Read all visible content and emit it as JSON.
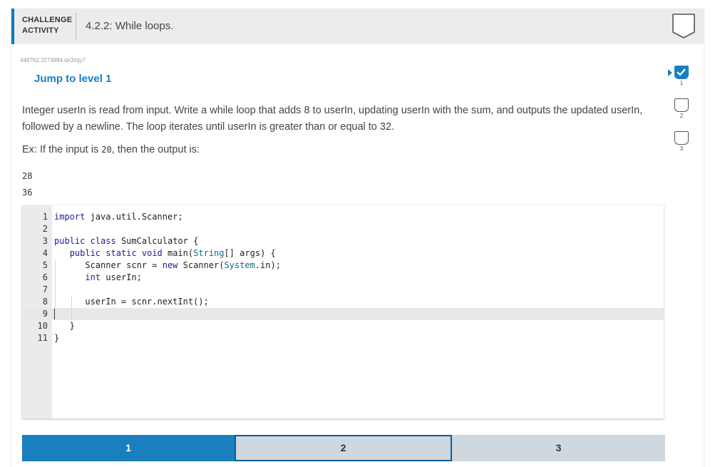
{
  "header": {
    "type_line1": "CHALLENGE",
    "type_line2": "ACTIVITY",
    "title": "4.2.2: While loops."
  },
  "activity_id": "448762.3274894.qx3zqy7",
  "jump_label": "Jump to level 1",
  "prompt": {
    "text": "Integer userIn is read from input. Write a while loop that adds 8 to userIn, updating userIn with the sum, and outputs the updated userIn, followed by a newline. The loop iterates until userIn is greater than or equal to 32.",
    "example_prefix": "Ex: If the input is ",
    "example_value": "20",
    "example_suffix": ", then the output is:",
    "output_lines": [
      "28",
      "36"
    ]
  },
  "code": {
    "line_numbers": [
      "1",
      "2",
      "3",
      "4",
      "5",
      "6",
      "7",
      "8",
      "9",
      "10",
      "11"
    ],
    "lines": [
      "import java.util.Scanner;",
      "",
      "public class SumCalculator {",
      "   public static void main(String[] args) {",
      "      Scanner scnr = new Scanner(System.in);",
      "      int userIn;",
      "",
      "      userIn = scnr.nextInt();",
      "",
      "   }",
      "}"
    ],
    "active_line": 9
  },
  "side_levels": [
    {
      "label": "1",
      "status": "current-completed"
    },
    {
      "label": "2",
      "status": "incomplete"
    },
    {
      "label": "3",
      "status": "incomplete"
    }
  ],
  "level_tabs": [
    {
      "label": "1",
      "state": "active"
    },
    {
      "label": "2",
      "state": "focused"
    },
    {
      "label": "3",
      "state": "default"
    }
  ],
  "colors": {
    "accent": "#1a7fbe",
    "header_bg": "#ececec",
    "tab_inactive": "#cfd8de",
    "tab_focus_border": "#0b5c98"
  }
}
